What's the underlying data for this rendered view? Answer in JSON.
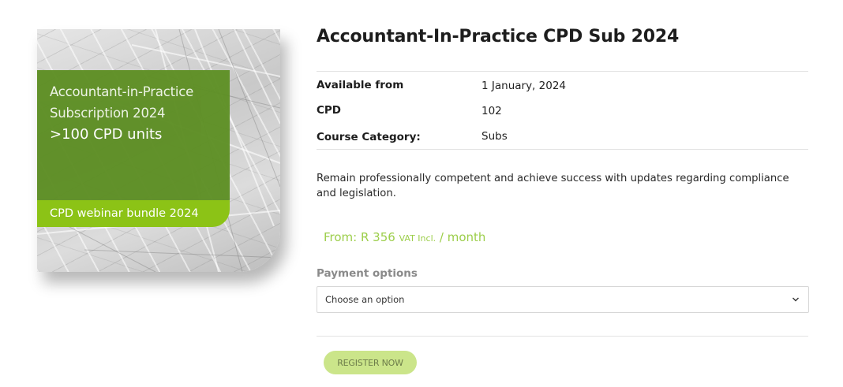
{
  "product": {
    "title": "Accountant-In-Practice CPD Sub 2024",
    "image": {
      "title_line1": "Accountant-in-Practice",
      "title_line2": "Subscription 2024",
      "units": ">100 CPD units",
      "band": "CPD webinar bundle 2024"
    },
    "meta": [
      {
        "key": "Available from",
        "value": "1 January, 2024"
      },
      {
        "key": "CPD",
        "value": "102"
      },
      {
        "key": "Course Category:",
        "value": "Subs"
      }
    ],
    "description": "Remain professionally competent and achieve success with updates regarding compliance and legislation.",
    "price": {
      "prefix": "From: R 356",
      "vat": "VAT Incl.",
      "suffix": "/ month"
    },
    "payment": {
      "label": "Payment options",
      "selected": "Choose an option"
    },
    "register_label": "REGISTER NOW"
  },
  "colors": {
    "accent_green": "#5e8f25",
    "lime": "#8cc316",
    "price_green": "#9cce4a",
    "button_bg": "#cbe58a"
  }
}
